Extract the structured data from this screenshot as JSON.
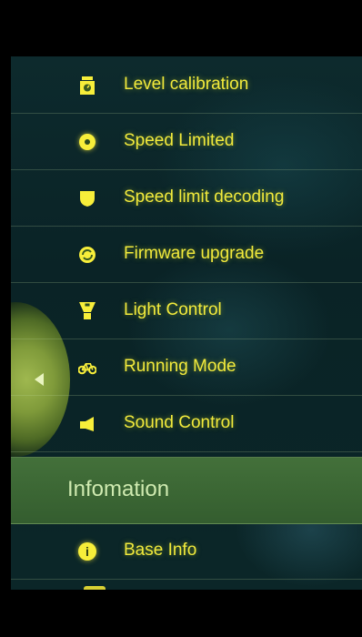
{
  "menu": {
    "items": [
      {
        "label": "Level calibration",
        "icon": "scale-icon"
      },
      {
        "label": "Speed Limited",
        "icon": "speedometer-icon"
      },
      {
        "label": "Speed limit decoding",
        "icon": "shield-icon"
      },
      {
        "label": "Firmware upgrade",
        "icon": "refresh-icon"
      },
      {
        "label": "Light Control",
        "icon": "light-icon"
      },
      {
        "label": "Running Mode",
        "icon": "bike-icon"
      },
      {
        "label": "Sound Control",
        "icon": "speaker-icon"
      }
    ]
  },
  "section": {
    "title": "Infomation",
    "items": [
      {
        "label": "Base Info",
        "icon": "info-icon"
      }
    ]
  },
  "colors": {
    "accent": "#f2ea3c",
    "section_bg": "#3a6533",
    "panel_bg": "#0d2a2d"
  }
}
